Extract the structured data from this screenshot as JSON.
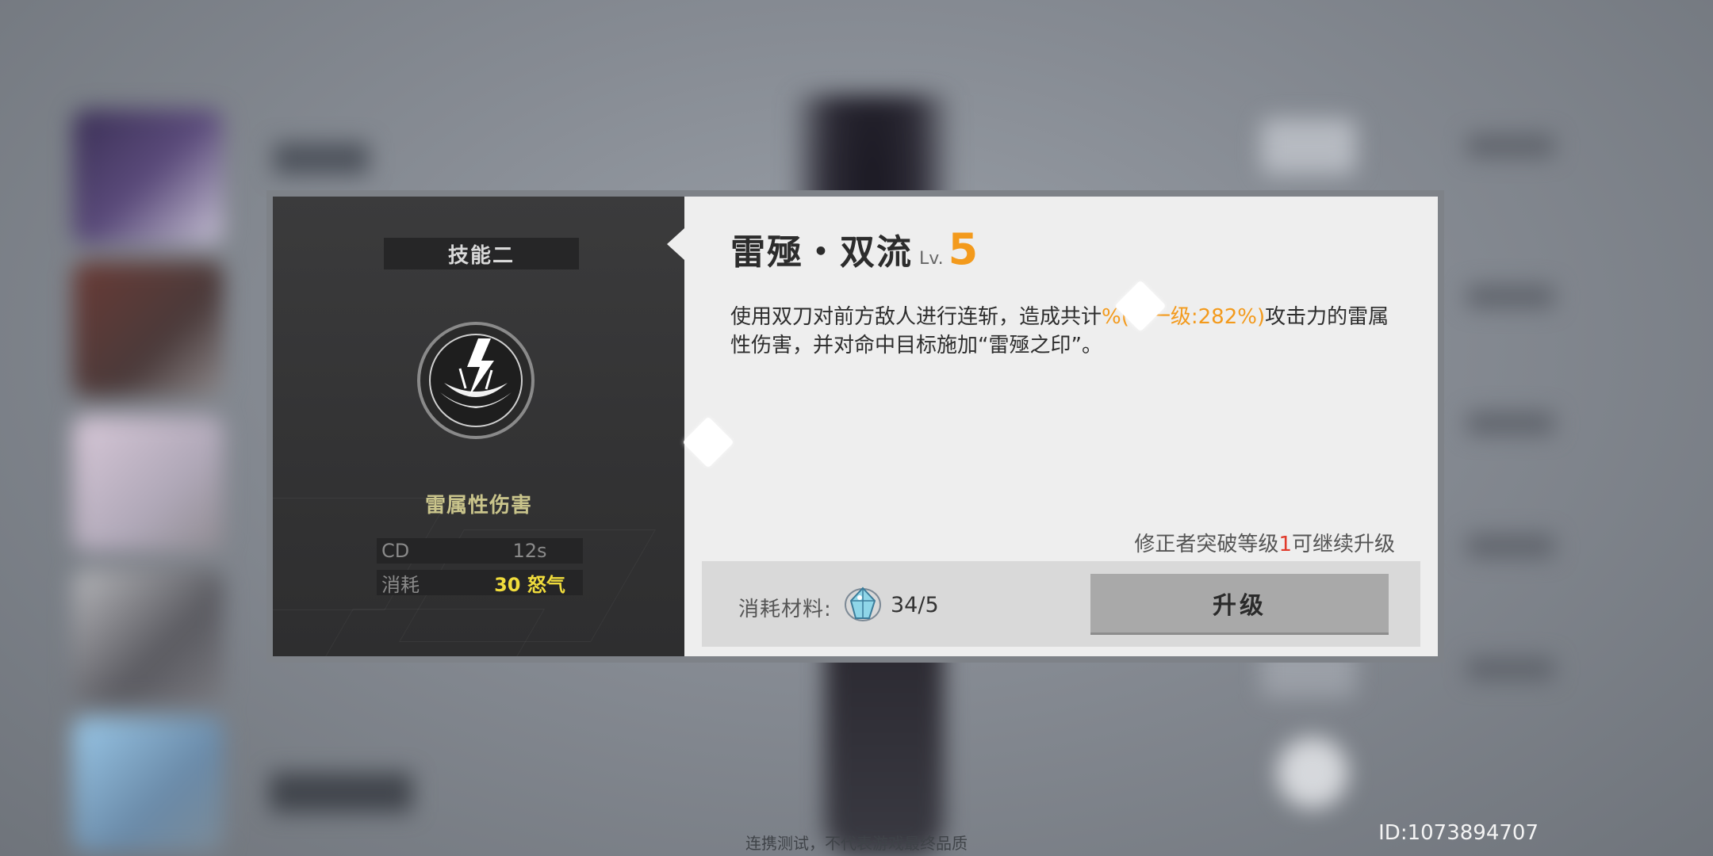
{
  "skill_panel": {
    "tag": "技能二",
    "element": "雷属性伤害",
    "stats": [
      {
        "key": "CD",
        "value": "12s"
      },
      {
        "key": "消耗",
        "value": "30 怒气"
      }
    ]
  },
  "skill_detail": {
    "name": "雷殛・双流",
    "level_prefix": "Lv.",
    "level": "5",
    "description": {
      "part1": "使用双刀对前方敌人进行连斩，造成共计",
      "highlight": "%(下一级:282%)",
      "part2": "攻击力的雷属性伤害，并对命中目标施加“雷殛之印”。"
    },
    "hint": {
      "before": "修正者突破等级",
      "num": "1",
      "after": "可继续升级"
    },
    "cost": {
      "label": "消耗材料:",
      "count": "34/5",
      "icon": "material-crystal-icon"
    },
    "upgrade_label": "升级"
  },
  "footer": {
    "note": "连携测试，不代表游戏最终品质",
    "uid": "ID:1073894707"
  },
  "colors": {
    "accent": "#f39a1c",
    "rage": "#f0dc3c",
    "element": "#c9c48b",
    "warning": "#e03a2b"
  }
}
